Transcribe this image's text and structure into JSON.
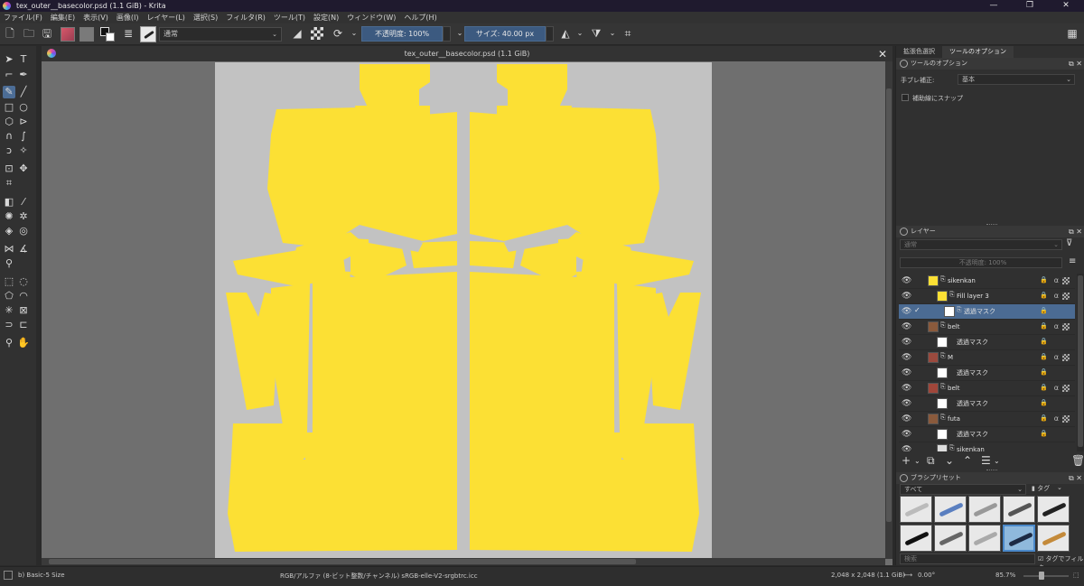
{
  "window": {
    "title": "tex_outer__basecolor.psd (1.1 GiB)  - Krita",
    "minimize": "—",
    "maximize": "❐",
    "close": "✕"
  },
  "menu": [
    "ファイル(F)",
    "編集(E)",
    "表示(V)",
    "画像(I)",
    "レイヤー(L)",
    "選択(S)",
    "フィルタ(R)",
    "ツール(T)",
    "設定(N)",
    "ウィンドウ(W)",
    "ヘルプ(H)"
  ],
  "toolbar": {
    "blend_mode": "通常",
    "opacity": "不透明度: 100%",
    "size": "サイズ: 40.00 px"
  },
  "document": {
    "tab_title": "tex_outer__basecolor.psd (1.1 GiB)",
    "close": "✕"
  },
  "canvas": {
    "background_color": "#c2c2c2",
    "uv_color": "#fce034"
  },
  "dock": {
    "tabs": [
      "拡張色選択",
      "ツールのオプション"
    ],
    "tool_options": {
      "title": "ツールのオプション",
      "stabilizer_label": "手ブレ補正:",
      "stabilizer_value": "基本",
      "snap_label": "補助線にスナップ"
    },
    "layers": {
      "title": "レイヤー",
      "blend_mode": "通常",
      "opacity": "不透明度: 100%",
      "items": [
        {
          "name": "sikenkan",
          "kind": "group",
          "thumb": "yellow",
          "depth": 0,
          "selected": false,
          "check": ""
        },
        {
          "name": "Fill layer 3",
          "kind": "fill",
          "thumb": "yellow",
          "depth": 1,
          "selected": false,
          "check": ""
        },
        {
          "name": "透過マスク",
          "kind": "mask",
          "thumb": "white",
          "depth": 2,
          "selected": true,
          "check": "✓"
        },
        {
          "name": "belt",
          "kind": "group",
          "thumb": "brown",
          "depth": 1,
          "selected": false,
          "check": ""
        },
        {
          "name": "透過マスク",
          "kind": "mask",
          "thumb": "white",
          "depth": 2,
          "selected": false,
          "check": ""
        },
        {
          "name": "M",
          "kind": "group",
          "thumb": "red",
          "depth": 1,
          "selected": false,
          "check": ""
        },
        {
          "name": "透過マスク",
          "kind": "mask",
          "thumb": "white",
          "depth": 2,
          "selected": false,
          "check": ""
        },
        {
          "name": "belt",
          "kind": "group",
          "thumb": "red",
          "depth": 1,
          "selected": false,
          "check": ""
        },
        {
          "name": "透過マスク",
          "kind": "mask",
          "thumb": "white",
          "depth": 2,
          "selected": false,
          "check": ""
        },
        {
          "name": "futa",
          "kind": "group",
          "thumb": "brown",
          "depth": 1,
          "selected": false,
          "check": ""
        },
        {
          "name": "透過マスク",
          "kind": "mask",
          "thumb": "white",
          "depth": 2,
          "selected": false,
          "check": ""
        },
        {
          "name": "sikenkan",
          "kind": "group",
          "thumb": "grey",
          "depth": 1,
          "selected": false,
          "check": ""
        }
      ]
    },
    "brush_presets": {
      "title": "ブラシプリセット",
      "filter": "すべて",
      "tag_label": "タグ",
      "search_placeholder": "検索",
      "tag_filter_label": "タグでフィルタ"
    }
  },
  "status": {
    "brush": "b) Basic-5 Size",
    "color_space": "RGB/アルファ (8-ビット整数/チャンネル)  sRGB-elle-V2-srgbtrc.icc",
    "image_size": "2,048 x 2,048 (1.1 GiB)",
    "rotation": "0.00°",
    "zoom": "85.7%"
  }
}
